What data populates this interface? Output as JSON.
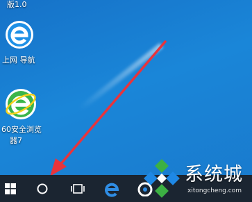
{
  "desktop": {
    "icons": [
      {
        "label": "版1.0"
      },
      {
        "label": "上网 导航"
      },
      {
        "label_line1": "60安全浏览",
        "label_line2": "器7"
      }
    ]
  },
  "taskbar": {
    "items": [
      "windows-start",
      "search-cortana",
      "task-view",
      "edge",
      "cloud"
    ]
  },
  "watermark": {
    "text": "系统城",
    "url": "xitongcheng.com"
  },
  "colors": {
    "desktop": "#1a86d8",
    "taskbar": "#1b2531",
    "arrow": "#e8343c",
    "watermark_green": "#3cb043",
    "watermark_blue": "#1e88e5"
  }
}
